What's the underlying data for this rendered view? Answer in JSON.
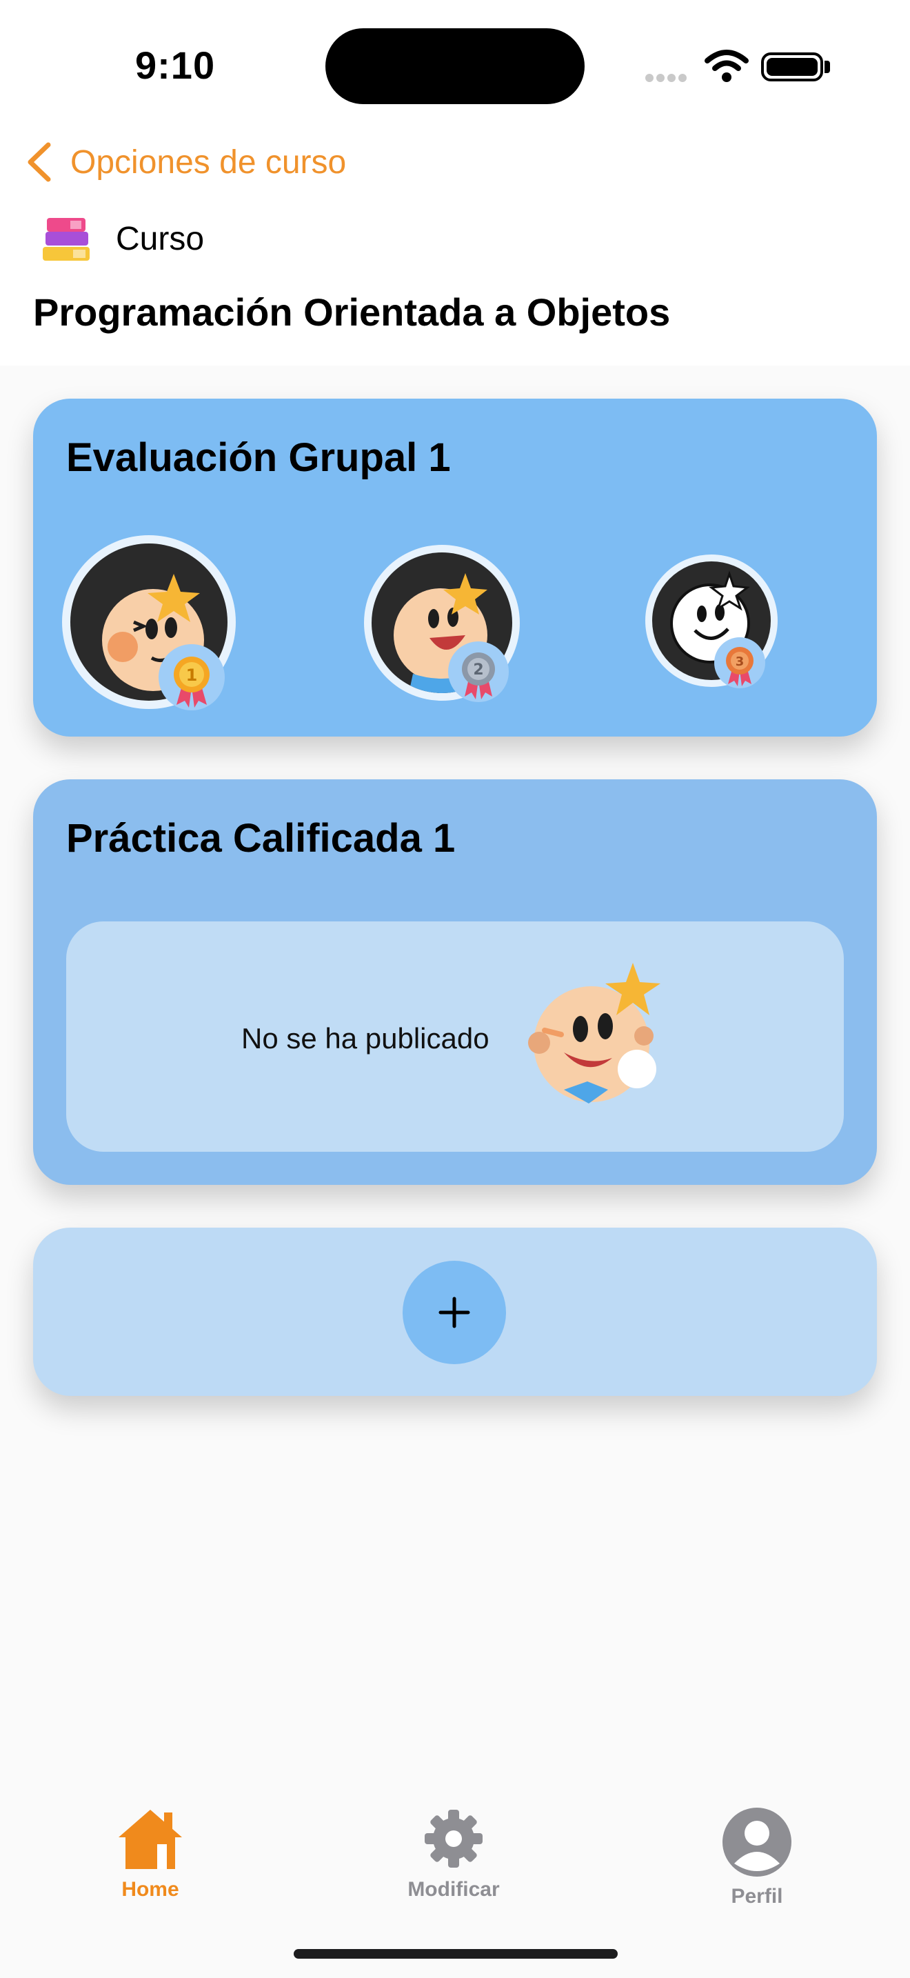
{
  "status_bar": {
    "time": "9:10"
  },
  "nav": {
    "back_label": "Opciones de curso"
  },
  "course": {
    "label": "Curso",
    "title": "Programación Orientada a Objetos"
  },
  "evaluations": [
    {
      "title": "Evaluación Grupal 1",
      "ranking": [
        "first-place",
        "second-place",
        "third-place"
      ]
    },
    {
      "title": "Práctica Calificada 1",
      "status_text": "No se ha publicado"
    }
  ],
  "add_button": {
    "icon": "plus-icon"
  },
  "tab_bar": {
    "items": [
      {
        "label": "Home",
        "icon": "home-icon",
        "active": true
      },
      {
        "label": "Modificar",
        "icon": "gear-icon",
        "active": false
      },
      {
        "label": "Perfil",
        "icon": "profile-icon",
        "active": false
      }
    ]
  },
  "colors": {
    "accent": "#f08a1c",
    "card_primary": "#7dbcf3",
    "card_secondary": "#8bbdee",
    "card_light": "#bddaf5",
    "inactive": "#8e8e93"
  }
}
